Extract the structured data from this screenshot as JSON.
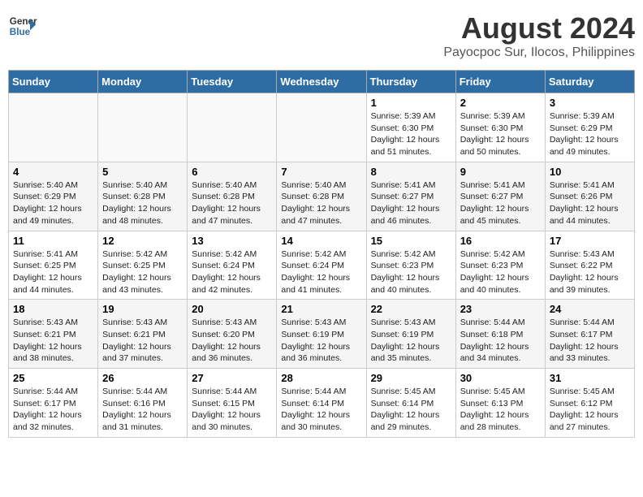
{
  "header": {
    "logo_line1": "General",
    "logo_line2": "Blue",
    "month_year": "August 2024",
    "location": "Payocpoc Sur, Ilocos, Philippines"
  },
  "weekdays": [
    "Sunday",
    "Monday",
    "Tuesday",
    "Wednesday",
    "Thursday",
    "Friday",
    "Saturday"
  ],
  "weeks": [
    [
      {
        "day": "",
        "info": ""
      },
      {
        "day": "",
        "info": ""
      },
      {
        "day": "",
        "info": ""
      },
      {
        "day": "",
        "info": ""
      },
      {
        "day": "1",
        "info": "Sunrise: 5:39 AM\nSunset: 6:30 PM\nDaylight: 12 hours and 51 minutes."
      },
      {
        "day": "2",
        "info": "Sunrise: 5:39 AM\nSunset: 6:30 PM\nDaylight: 12 hours and 50 minutes."
      },
      {
        "day": "3",
        "info": "Sunrise: 5:39 AM\nSunset: 6:29 PM\nDaylight: 12 hours and 49 minutes."
      }
    ],
    [
      {
        "day": "4",
        "info": "Sunrise: 5:40 AM\nSunset: 6:29 PM\nDaylight: 12 hours and 49 minutes."
      },
      {
        "day": "5",
        "info": "Sunrise: 5:40 AM\nSunset: 6:28 PM\nDaylight: 12 hours and 48 minutes."
      },
      {
        "day": "6",
        "info": "Sunrise: 5:40 AM\nSunset: 6:28 PM\nDaylight: 12 hours and 47 minutes."
      },
      {
        "day": "7",
        "info": "Sunrise: 5:40 AM\nSunset: 6:28 PM\nDaylight: 12 hours and 47 minutes."
      },
      {
        "day": "8",
        "info": "Sunrise: 5:41 AM\nSunset: 6:27 PM\nDaylight: 12 hours and 46 minutes."
      },
      {
        "day": "9",
        "info": "Sunrise: 5:41 AM\nSunset: 6:27 PM\nDaylight: 12 hours and 45 minutes."
      },
      {
        "day": "10",
        "info": "Sunrise: 5:41 AM\nSunset: 6:26 PM\nDaylight: 12 hours and 44 minutes."
      }
    ],
    [
      {
        "day": "11",
        "info": "Sunrise: 5:41 AM\nSunset: 6:25 PM\nDaylight: 12 hours and 44 minutes."
      },
      {
        "day": "12",
        "info": "Sunrise: 5:42 AM\nSunset: 6:25 PM\nDaylight: 12 hours and 43 minutes."
      },
      {
        "day": "13",
        "info": "Sunrise: 5:42 AM\nSunset: 6:24 PM\nDaylight: 12 hours and 42 minutes."
      },
      {
        "day": "14",
        "info": "Sunrise: 5:42 AM\nSunset: 6:24 PM\nDaylight: 12 hours and 41 minutes."
      },
      {
        "day": "15",
        "info": "Sunrise: 5:42 AM\nSunset: 6:23 PM\nDaylight: 12 hours and 40 minutes."
      },
      {
        "day": "16",
        "info": "Sunrise: 5:42 AM\nSunset: 6:23 PM\nDaylight: 12 hours and 40 minutes."
      },
      {
        "day": "17",
        "info": "Sunrise: 5:43 AM\nSunset: 6:22 PM\nDaylight: 12 hours and 39 minutes."
      }
    ],
    [
      {
        "day": "18",
        "info": "Sunrise: 5:43 AM\nSunset: 6:21 PM\nDaylight: 12 hours and 38 minutes."
      },
      {
        "day": "19",
        "info": "Sunrise: 5:43 AM\nSunset: 6:21 PM\nDaylight: 12 hours and 37 minutes."
      },
      {
        "day": "20",
        "info": "Sunrise: 5:43 AM\nSunset: 6:20 PM\nDaylight: 12 hours and 36 minutes."
      },
      {
        "day": "21",
        "info": "Sunrise: 5:43 AM\nSunset: 6:19 PM\nDaylight: 12 hours and 36 minutes."
      },
      {
        "day": "22",
        "info": "Sunrise: 5:43 AM\nSunset: 6:19 PM\nDaylight: 12 hours and 35 minutes."
      },
      {
        "day": "23",
        "info": "Sunrise: 5:44 AM\nSunset: 6:18 PM\nDaylight: 12 hours and 34 minutes."
      },
      {
        "day": "24",
        "info": "Sunrise: 5:44 AM\nSunset: 6:17 PM\nDaylight: 12 hours and 33 minutes."
      }
    ],
    [
      {
        "day": "25",
        "info": "Sunrise: 5:44 AM\nSunset: 6:17 PM\nDaylight: 12 hours and 32 minutes."
      },
      {
        "day": "26",
        "info": "Sunrise: 5:44 AM\nSunset: 6:16 PM\nDaylight: 12 hours and 31 minutes."
      },
      {
        "day": "27",
        "info": "Sunrise: 5:44 AM\nSunset: 6:15 PM\nDaylight: 12 hours and 30 minutes."
      },
      {
        "day": "28",
        "info": "Sunrise: 5:44 AM\nSunset: 6:14 PM\nDaylight: 12 hours and 30 minutes."
      },
      {
        "day": "29",
        "info": "Sunrise: 5:45 AM\nSunset: 6:14 PM\nDaylight: 12 hours and 29 minutes."
      },
      {
        "day": "30",
        "info": "Sunrise: 5:45 AM\nSunset: 6:13 PM\nDaylight: 12 hours and 28 minutes."
      },
      {
        "day": "31",
        "info": "Sunrise: 5:45 AM\nSunset: 6:12 PM\nDaylight: 12 hours and 27 minutes."
      }
    ]
  ]
}
